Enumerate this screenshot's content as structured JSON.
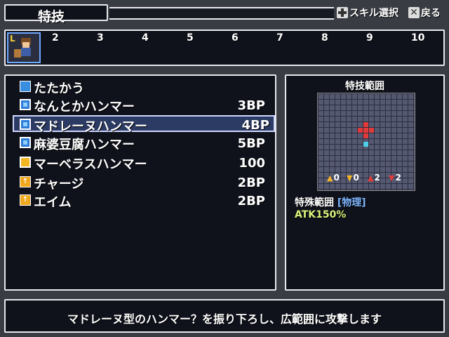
{
  "header": {
    "title": "特技",
    "hint_select": "スキル選択",
    "hint_back": "戻る"
  },
  "party": {
    "level_badge": "L",
    "slots": [
      "2",
      "3",
      "4",
      "5",
      "6",
      "7",
      "8",
      "9",
      "10"
    ]
  },
  "skills": [
    {
      "name": "たたかう",
      "cost": "",
      "icon": "sword-icon"
    },
    {
      "name": "なんとかハンマー",
      "cost": "3BP",
      "icon": "hammer-icon"
    },
    {
      "name": "マドレーヌハンマー",
      "cost": "4BP",
      "icon": "hammer-icon",
      "selected": true
    },
    {
      "name": "麻婆豆腐ハンマー",
      "cost": "5BP",
      "icon": "hammer-icon"
    },
    {
      "name": "マーベラスハンマー",
      "cost": "100",
      "icon": "special-hammer-icon"
    },
    {
      "name": "チャージ",
      "cost": "2BP",
      "icon": "buff-icon"
    },
    {
      "name": "エイム",
      "cost": "2BP",
      "icon": "buff-icon"
    }
  ],
  "range": {
    "title": "特技範囲",
    "stats": [
      "0",
      "0",
      "2",
      "2"
    ],
    "type_label": "特殊範囲",
    "type_tag": "[物理]",
    "atk": "ATK150%"
  },
  "description": "マドレーヌ型のハンマー？を振り下ろし、広範囲に攻撃します",
  "colors": {
    "accent_blue": "#6fa8ff",
    "range_red": "#e23a3a",
    "range_cyan": "#4fd0e8",
    "atk_green": "#d9f27a"
  }
}
